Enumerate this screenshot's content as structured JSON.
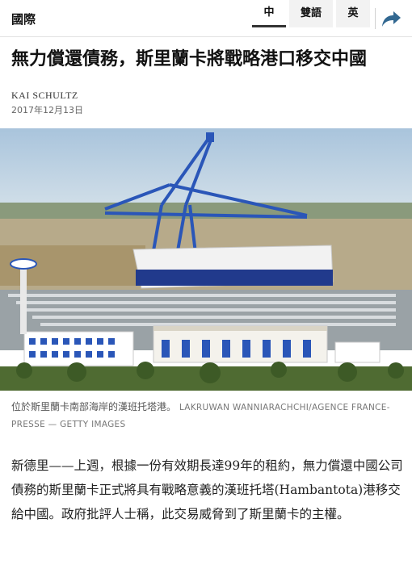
{
  "nav": {
    "section": "國際",
    "languages": {
      "simplified": "中",
      "dual": "雙語",
      "english": "英"
    },
    "active_language": "中",
    "share_icon": "share-arrow-icon"
  },
  "article": {
    "headline": "無力償還債務，斯里蘭卡將戰略港口移交中國",
    "byline": "KAI SCHULTZ",
    "date": "2017年12月13日",
    "photo": {
      "alt_subject": "hambantota-port-photo",
      "caption": "位於斯里蘭卡南部海岸的漢班托塔港。",
      "credit": "LAKRUWAN WANNIARACHCHI/AGENCE FRANCE-PRESSE — GETTY IMAGES"
    },
    "lead_paragraph": "新德里——上週，根據一份有效期長達99年的租約，無力償還中國公司債務的斯里蘭卡正式將具有戰略意義的漢班托塔(Hambantota)港移交給中國。政府批評人士稱，此交易威脅到了斯里蘭卡的主權。"
  },
  "colors": {
    "text": "#121212",
    "muted": "#666666",
    "share_icon": "#326891",
    "crane_blue": "#2a56b8"
  }
}
